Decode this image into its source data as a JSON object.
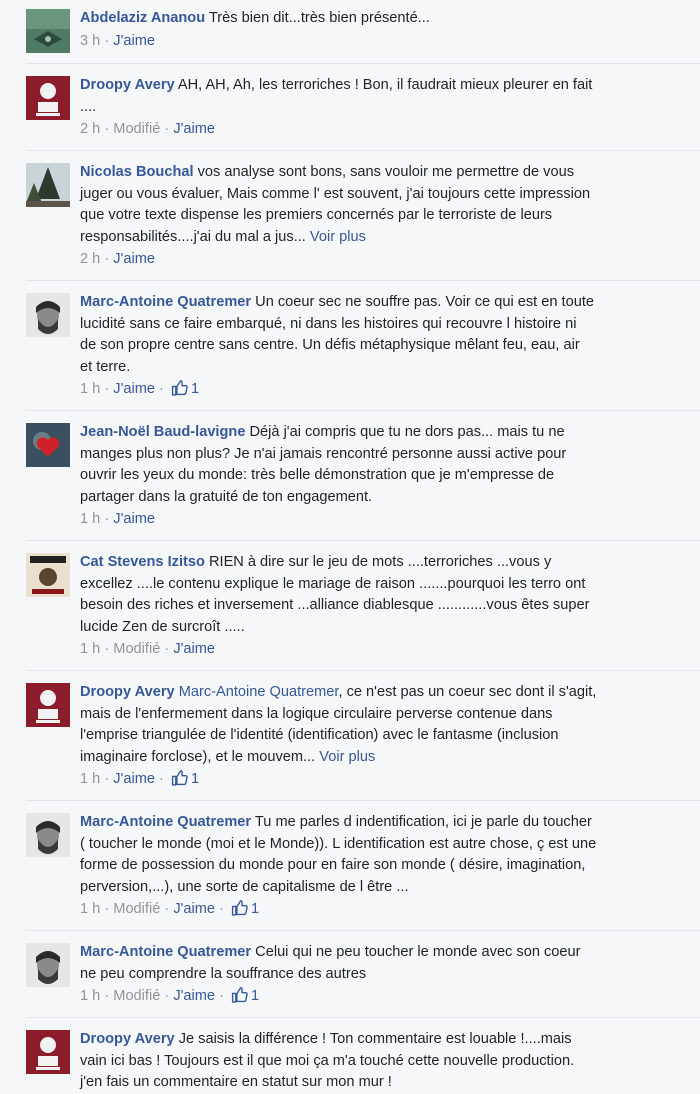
{
  "comments": [
    {
      "author": "Abdelaziz Ananou",
      "text": "Très bien dit...très bien présenté...",
      "time": "3 h",
      "like": "J'aime"
    },
    {
      "author": "Droopy Avery",
      "text_l1": "AH, AH, Ah, les terroriches ! Bon, il faudrait mieux pleurer en fait",
      "text_l2": "....",
      "time": "2 h",
      "modified": "Modifié",
      "like": "J'aime"
    },
    {
      "author": "Nicolas Bouchal",
      "text_l1": "vos analyse sont bons, sans vouloir me permettre de vous",
      "text_l2": "juger ou vous évaluer, Mais comme l' est souvent, j'ai toujours cette impression",
      "text_l3": "que votre texte dispense les premiers concernés par le terroriste de leurs",
      "text_l4": "responsabilités....j'ai du mal a jus...",
      "see_more": "Voir plus",
      "time": "2 h",
      "like": "J'aime"
    },
    {
      "author": "Marc-Antoine Quatremer",
      "text_l1": "Un coeur sec ne souffre pas. Voir ce qui est en toute",
      "text_l2": "lucidité sans ce faire embarqué, ni dans les histoires qui recouvre l histoire ni",
      "text_l3": "de son propre centre sans centre. Un défis métaphysique mêlant feu, eau, air",
      "text_l4": "et terre.",
      "time": "1 h",
      "like": "J'aime",
      "like_count": "1"
    },
    {
      "author": "Jean-Noël Baud-lavigne",
      "text_l1": "Déjà j'ai compris que tu ne dors pas... mais tu ne",
      "text_l2": "manges plus non plus? Je n'ai jamais rencontré personne aussi active pour",
      "text_l3": "ouvrir les yeux du monde: très belle démonstration que je m'empresse de",
      "text_l4": "partager dans la gratuité de ton engagement.",
      "time": "1 h",
      "like": "J'aime"
    },
    {
      "author": "Cat Stevens Izitso",
      "text_l1": "RIEN à dire sur le jeu de mots ....terroriches ...vous y",
      "text_l2": "excellez ....le contenu explique le mariage de raison .......pourquoi les terro ont",
      "text_l3": "besoin des riches et inversement ...alliance diablesque ............vous êtes super",
      "text_l4": "lucide Zen de surcroît .....",
      "time": "1 h",
      "modified": "Modifié",
      "like": "J'aime"
    },
    {
      "author": "Droopy Avery",
      "mention": "Marc-Antoine Quatremer",
      "text_l1": ", ce n'est pas un coeur sec dont il s'agit,",
      "text_l2": "mais de l'enfermement dans la logique circulaire perverse contenue dans",
      "text_l3": "l'emprise triangulée de l'identité (identification) avec le fantasme (inclusion",
      "text_l4": "imaginaire forclose), et le mouvem...",
      "see_more": "Voir plus",
      "time": "1 h",
      "like": "J'aime",
      "like_count": "1"
    },
    {
      "author": "Marc-Antoine Quatremer",
      "text_l1": "Tu me parles d indentification, ici je parle du toucher",
      "text_l2": "( toucher le monde (moi et le Monde)). L identification est autre chose, ç est une",
      "text_l3": "forme de possession du monde pour en faire son monde ( désire, imagination,",
      "text_l4": "perversion,...), une sorte de capitalisme de l être ...",
      "time": "1 h",
      "modified": "Modifié",
      "like": "J'aime",
      "like_count": "1"
    },
    {
      "author": "Marc-Antoine Quatremer",
      "text_l1": "Celui qui ne peu toucher le monde avec son coeur",
      "text_l2": "ne peu comprendre la souffrance des autres",
      "time": "1 h",
      "modified": "Modifié",
      "like": "J'aime",
      "like_count": "1"
    },
    {
      "author": "Droopy Avery",
      "text_l1": "Je saisis la différence ! Ton commentaire est louable !....mais",
      "text_l2": "vain ici bas ! Toujours est il que moi ça m'a touché cette nouvelle production.",
      "text_l3": "j'en fais un commentaire en statut sur mon mur !"
    }
  ],
  "colors": {
    "link": "#365899",
    "meta": "#90949c",
    "background": "#f6f7f9",
    "text": "#1d2129"
  },
  "icons": {
    "like": "thumbs-up-icon"
  }
}
